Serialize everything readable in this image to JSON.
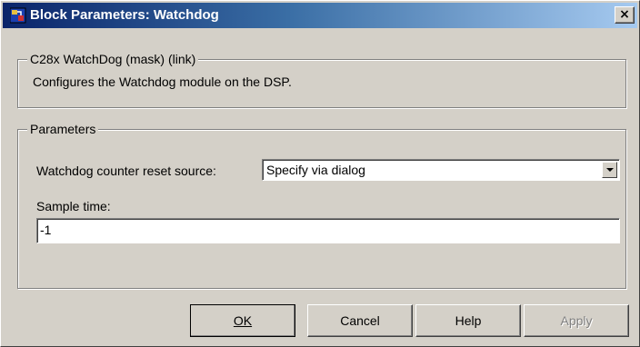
{
  "window": {
    "title": "Block Parameters: Watchdog",
    "close_label": "×"
  },
  "description_group": {
    "legend": "C28x WatchDog (mask) (link)",
    "text": "Configures the Watchdog module on the DSP."
  },
  "parameters_group": {
    "legend": "Parameters",
    "reset_source": {
      "label": "Watchdog counter reset source:",
      "value": "Specify via dialog"
    },
    "sample_time": {
      "label": "Sample time:",
      "value": "-1"
    }
  },
  "buttons": {
    "ok": "OK",
    "cancel": "Cancel",
    "help": "Help",
    "apply": "Apply"
  },
  "colors": {
    "title_bar_start": "#0a246a",
    "title_bar_end": "#a6caf0",
    "dialog_face": "#d4d0c8"
  }
}
